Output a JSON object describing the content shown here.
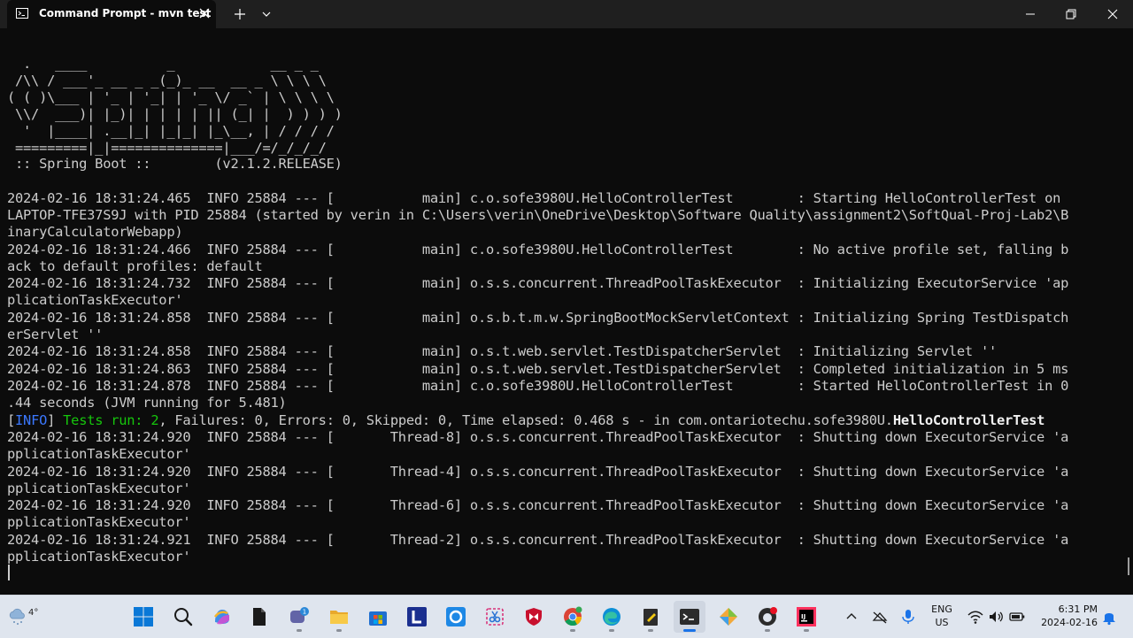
{
  "window": {
    "tab_title": "Command Prompt - mvn  test"
  },
  "colors": {
    "terminal_bg": "#0c0c0c",
    "terminal_text": "#cccccc",
    "info_blue": "#3b78ff",
    "success_green": "#16c60c",
    "titlebar_bg": "#1f1f1f",
    "taskbar_bg": "#dfe5ee"
  },
  "terminal": {
    "lines": [
      "",
      "  .   ____          _            __ _ _",
      " /\\\\ / ___'_ __ _ _(_)_ __  __ _ \\ \\ \\ \\",
      "( ( )\\___ | '_ | '_| | '_ \\/ _` | \\ \\ \\ \\",
      " \\\\/  ___)| |_)| | | | | || (_| |  ) ) ) )",
      "  '  |____| .__|_| |_|_| |_\\__, | / / / /",
      " =========|_|==============|___/=/_/_/_/",
      " :: Spring Boot ::        (v2.1.2.RELEASE)",
      "",
      "2024-02-16 18:31:24.465  INFO 25884 --- [           main] c.o.sofe3980U.HelloControllerTest        : Starting HelloControllerTest on",
      "LAPTOP-TFE37S9J with PID 25884 (started by verin in C:\\Users\\verin\\OneDrive\\Desktop\\Software Quality\\assignment2\\SoftQual-Proj-Lab2\\B",
      "inaryCalculatorWebapp)",
      "2024-02-16 18:31:24.466  INFO 25884 --- [           main] c.o.sofe3980U.HelloControllerTest        : No active profile set, falling b",
      "ack to default profiles: default",
      "2024-02-16 18:31:24.732  INFO 25884 --- [           main] o.s.s.concurrent.ThreadPoolTaskExecutor  : Initializing ExecutorService 'ap",
      "plicationTaskExecutor'",
      "2024-02-16 18:31:24.858  INFO 25884 --- [           main] o.s.b.t.m.w.SpringBootMockServletContext : Initializing Spring TestDispatch",
      "erServlet ''",
      "2024-02-16 18:31:24.858  INFO 25884 --- [           main] o.s.t.web.servlet.TestDispatcherServlet  : Initializing Servlet ''",
      "2024-02-16 18:31:24.863  INFO 25884 --- [           main] o.s.t.web.servlet.TestDispatcherServlet  : Completed initialization in 5 ms",
      "2024-02-16 18:31:24.878  INFO 25884 --- [           main] c.o.sofe3980U.HelloControllerTest        : Started HelloControllerTest in 0",
      ".44 seconds (JVM running for 5.481)",
      null,
      "2024-02-16 18:31:24.920  INFO 25884 --- [       Thread-8] o.s.s.concurrent.ThreadPoolTaskExecutor  : Shutting down ExecutorService 'a",
      "pplicationTaskExecutor'",
      "2024-02-16 18:31:24.920  INFO 25884 --- [       Thread-4] o.s.s.concurrent.ThreadPoolTaskExecutor  : Shutting down ExecutorService 'a",
      "pplicationTaskExecutor'",
      "2024-02-16 18:31:24.920  INFO 25884 --- [       Thread-6] o.s.s.concurrent.ThreadPoolTaskExecutor  : Shutting down ExecutorService 'a",
      "pplicationTaskExecutor'",
      "2024-02-16 18:31:24.921  INFO 25884 --- [       Thread-2] o.s.s.concurrent.ThreadPoolTaskExecutor  : Shutting down ExecutorService 'a",
      "pplicationTaskExecutor'"
    ],
    "test_result": {
      "bracket_open": "[",
      "level": "INFO",
      "bracket_close": "] ",
      "tests_run": "Tests run: 2",
      "details": ", Failures: 0, Errors: 0, Skipped: 0, Time elapsed: 0.468 s - in com.ontariotechu.sofe3980U.",
      "class_name": "HelloControllerTest"
    }
  },
  "taskbar": {
    "weather_temp": "4°",
    "lang_line1": "ENG",
    "lang_line2": "US",
    "time": "6:31 PM",
    "date": "2024-02-16",
    "apps": [
      "start-icon",
      "search-icon",
      "copilot-icon",
      "file-icon",
      "chat-icon",
      "file-explorer-icon",
      "store-icon",
      "l-app-icon",
      "o-app-icon",
      "snipping-tool-icon",
      "mcafee-icon",
      "chrome-icon",
      "edge-icon",
      "notepad-icon",
      "terminal-icon",
      "paint-icon",
      "github-icon",
      "intellij-icon"
    ]
  }
}
